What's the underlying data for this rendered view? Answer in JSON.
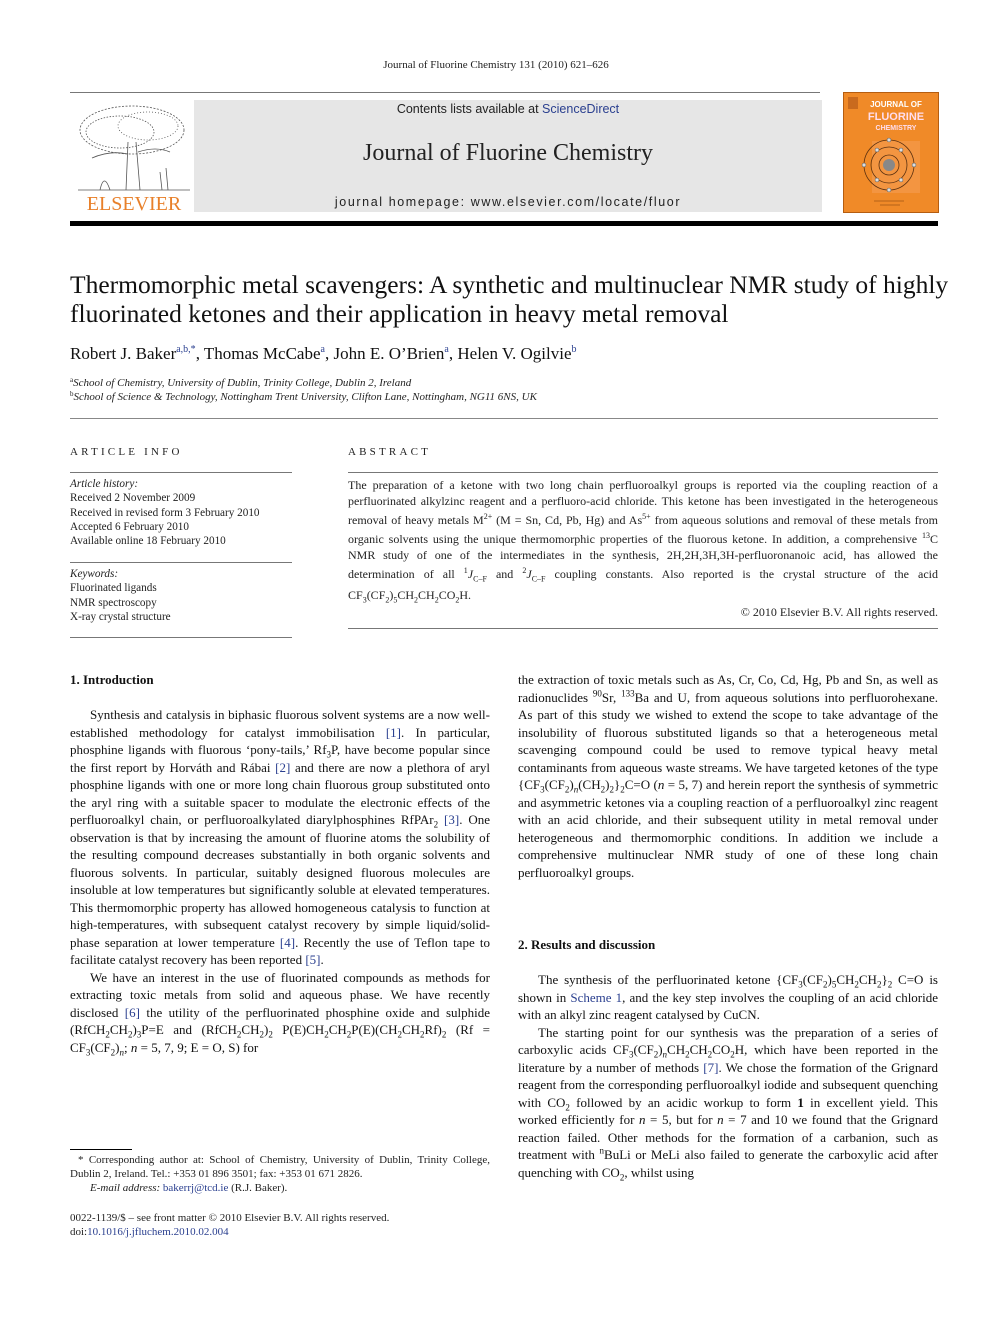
{
  "header": {
    "journal_reference": "Journal of Fluorine Chemistry 131 (2010) 621–626",
    "contents_prefix": "Contents lists available at ",
    "contents_link": "ScienceDirect",
    "journal_title": "Journal of Fluorine Chemistry",
    "homepage": "journal homepage: www.elsevier.com/locate/fluor",
    "publisher_logo_text": "ELSEVIER",
    "cover": {
      "line1": "JOURNAL OF",
      "line2": "FLUORINE",
      "line3": "CHEMISTRY",
      "color": "#f08a28"
    }
  },
  "article": {
    "title": "Thermomorphic metal scavengers: A synthetic and multinuclear NMR study of highly fluorinated ketones and their application in heavy metal removal",
    "authors": [
      {
        "name": "Robert J. Baker",
        "aff": "a,b,*",
        "sep": ", "
      },
      {
        "name": "Thomas McCabe",
        "aff": "a",
        "sep": ", "
      },
      {
        "name": "John E. O’Brien",
        "aff": "a",
        "sep": ", "
      },
      {
        "name": "Helen V. Ogilvie",
        "aff": "b",
        "sep": ""
      }
    ],
    "affiliations": [
      {
        "key": "a",
        "text": "School of Chemistry, University of Dublin, Trinity College, Dublin 2, Ireland"
      },
      {
        "key": "b",
        "text": "School of Science & Technology, Nottingham Trent University, Clifton Lane, Nottingham, NG11 6NS, UK"
      }
    ]
  },
  "article_info": {
    "label": "ARTICLE INFO",
    "history_label": "Article history:",
    "history": [
      "Received 2 November 2009",
      "Received in revised form 3 February 2010",
      "Accepted 6 February 2010",
      "Available online 18 February 2010"
    ],
    "keywords_label": "Keywords:",
    "keywords": [
      "Fluorinated ligands",
      "NMR spectroscopy",
      "X-ray crystal structure"
    ]
  },
  "abstract": {
    "label": "ABSTRACT",
    "p1": "The preparation of a ketone with two long chain perfluoroalkyl groups is reported via the coupling reaction of a perfluorinated alkylzinc reagent and a perfluoro-acid chloride. This ketone has been investigated in the heterogeneous removal of heavy metals M",
    "m_charge": "2+",
    "p2": " (M = Sn, Cd, Pb, Hg) and As",
    "as_charge": "5+",
    "p3": " from aqueous solutions and removal of these metals from organic solvents using the unique thermomorphic properties of the fluorous ketone. In addition, a comprehensive ",
    "c13": "13",
    "p4": "C NMR study of one of the intermediates in the synthesis, 2H,2H,3H,3H-perfluoronanoic acid, has allowed the determination of all ",
    "j1": "1",
    "p5": " and ",
    "j2": "2",
    "p6": " coupling constants. Also reported is the crystal structure of the acid CF",
    "p7": "H.",
    "jcf": "J",
    "jcf_sub": "C–F",
    "copyright": "© 2010 Elsevier B.V. All rights reserved."
  },
  "sections": {
    "intro_heading": "1.  Introduction",
    "results_heading": "2.  Results and discussion"
  },
  "refs": {
    "r1": "[1]",
    "r2": "[2]",
    "r3": "[3]",
    "r4": "[4]",
    "r5": "[5]",
    "r6": "[6]",
    "r7": "[7]",
    "scheme1": "Scheme 1"
  },
  "footnote": {
    "corresponding": "* Corresponding author at: School of Chemistry, University of Dublin, Trinity College, Dublin 2, Ireland. Tel.: +353 01 896 3501; fax: +353 01 671 2826.",
    "email_label": "E-mail address: ",
    "email": "bakerrj@tcd.ie",
    "email_suffix": " (R.J. Baker).",
    "issn": "0022-1139/$ – see front matter © 2010 Elsevier B.V. All rights reserved.",
    "doi_prefix": "doi:",
    "doi": "10.1016/j.jfluchem.2010.02.004"
  }
}
